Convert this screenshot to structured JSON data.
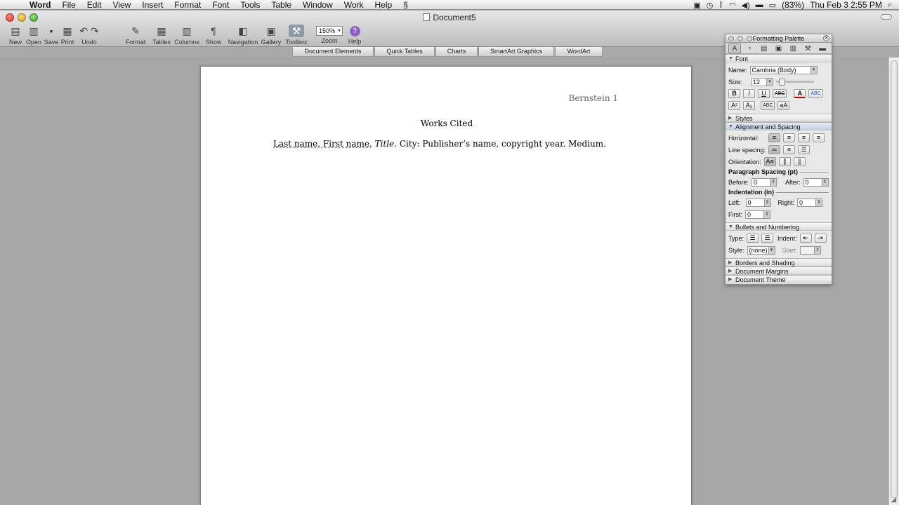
{
  "menubar": {
    "app_name": "Word",
    "menus": [
      "File",
      "Edit",
      "View",
      "Insert",
      "Format",
      "Font",
      "Tools",
      "Table",
      "Window",
      "Work",
      "Help"
    ],
    "battery": "(83%)",
    "datetime": "Thu Feb 3  2:55 PM"
  },
  "window": {
    "title": "Document5"
  },
  "toolbar": {
    "new": "New",
    "open": "Open",
    "save": "Save",
    "print": "Print",
    "undo": "Undo",
    "format": "Format",
    "tables": "Tables",
    "columns": "Columns",
    "show": "Show",
    "navigation": "Navigation",
    "gallery": "Gallery",
    "toolbox": "Toolbox",
    "zoom_label": "Zoom",
    "zoom_value": "150%",
    "help": "Help"
  },
  "ribbon": {
    "tabs": [
      "Document Elements",
      "Quick Tables",
      "Charts",
      "SmartArt Graphics",
      "WordArt"
    ]
  },
  "document": {
    "header": "Bernstein 1",
    "heading": "Works Cited",
    "citation_author": "Last name, First name.",
    "citation_title": "Title",
    "citation_rest": ". City: Publisher’s name, copyright year. Medium."
  },
  "palette": {
    "title": "Formatting Palette",
    "font_section": "Font",
    "name_label": "Name:",
    "name_value": "Cambria (Body)",
    "size_label": "Size:",
    "size_value": "12",
    "bold": "B",
    "italic": "I",
    "underline": "U",
    "strike": "ABC",
    "font_color": "A",
    "highlight": "ABC",
    "superscript": "A²",
    "subscript": "A₂",
    "smallcaps": "ABC",
    "change_case": "aA",
    "styles_section": "Styles",
    "align_section": "Alignment and Spacing",
    "horizontal_label": "Horizontal:",
    "line_spacing_label": "Line spacing:",
    "orientation_label": "Orientation:",
    "para_spacing_head": "Paragraph Spacing (pt)",
    "before_label": "Before:",
    "before_value": "0",
    "after_label": "After:",
    "after_value": "0",
    "indentation_head": "Indentation (in)",
    "left_label": "Left:",
    "left_value": "0",
    "right_label": "Right:",
    "right_value": "0",
    "first_label": "First:",
    "first_value": "0",
    "bullets_section": "Bullets and Numbering",
    "type_label": "Type:",
    "indent_label": "Indent:",
    "style_label": "Style:",
    "style_value": "(none)",
    "start_label": "Start:",
    "borders_section": "Borders and Shading",
    "margins_section": "Document Margins",
    "theme_section": "Document Theme"
  }
}
